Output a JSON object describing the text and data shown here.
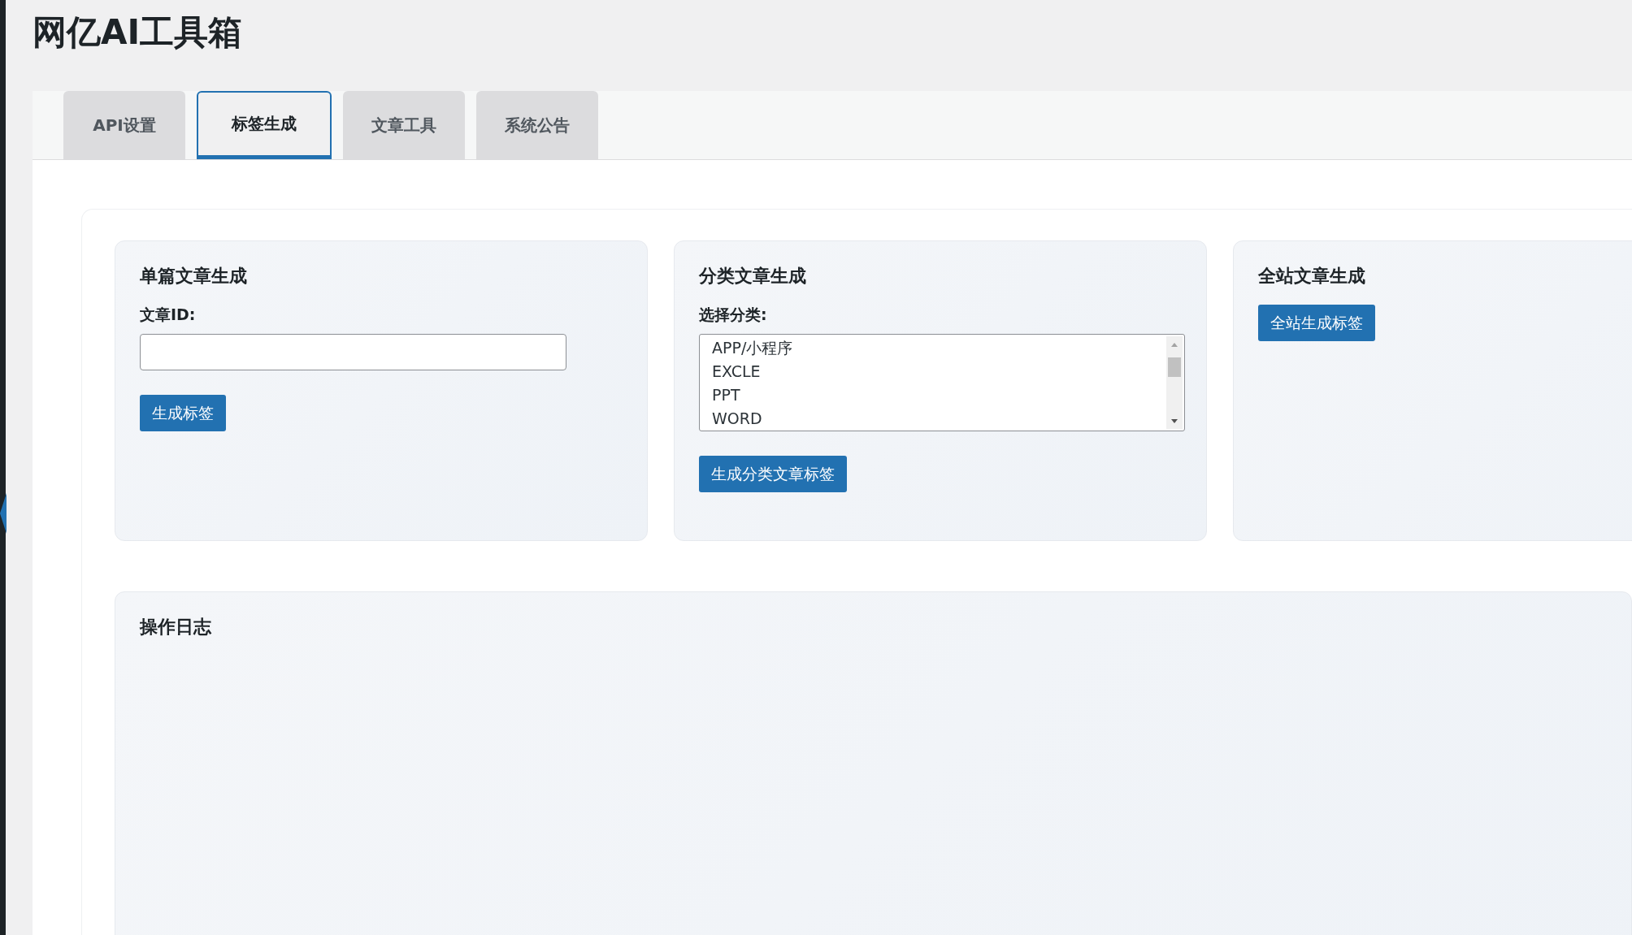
{
  "title": "网亿AI工具箱",
  "tabs": [
    {
      "label": "API设置",
      "selected": false
    },
    {
      "label": "标签生成",
      "selected": true
    },
    {
      "label": "文章工具",
      "selected": false
    },
    {
      "label": "系统公告",
      "selected": false
    }
  ],
  "cards": [
    {
      "kind": "single",
      "title": "单篇文章生成",
      "field_label": "文章ID:",
      "button": "生成标签"
    },
    {
      "kind": "category",
      "title": "分类文章生成",
      "field_label": "选择分类:",
      "options": [
        {
          "label": "APP/小程序",
          "selected": false
        },
        {
          "label": "EXCLE",
          "selected": false
        },
        {
          "label": "PPT",
          "selected": false
        },
        {
          "label": "WORD",
          "selected": false
        }
      ],
      "button": "生成分类文章标签"
    },
    {
      "kind": "site",
      "title": "全站文章生成",
      "button": "全站生成标签"
    }
  ],
  "log": {
    "title": "操作日志"
  }
}
